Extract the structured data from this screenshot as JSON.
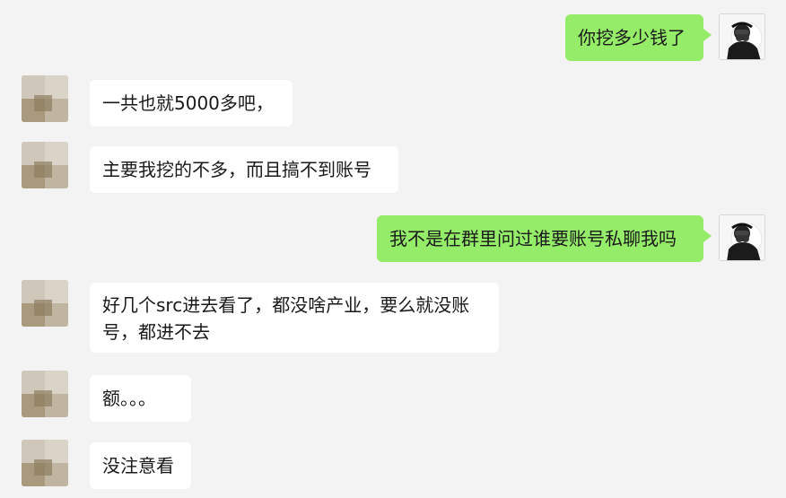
{
  "messages": [
    {
      "side": "right",
      "text": "你挖多少钱了"
    },
    {
      "side": "left",
      "text": "一共也就5000多吧，"
    },
    {
      "side": "left",
      "text": "主要我挖的不多，而且搞不到账号"
    },
    {
      "side": "right",
      "text": "我不是在群里问过谁要账号私聊我吗"
    },
    {
      "side": "left",
      "lines": [
        "好几个src进去看了，都没啥产业，要么就没账",
        "号，都进不去"
      ]
    },
    {
      "side": "left",
      "text": "额。。。"
    },
    {
      "side": "left",
      "text": "没注意看"
    }
  ],
  "colors": {
    "background": "#f3f3f3",
    "self_bubble": "#95ec69",
    "other_bubble": "#ffffff",
    "text": "#191919"
  }
}
